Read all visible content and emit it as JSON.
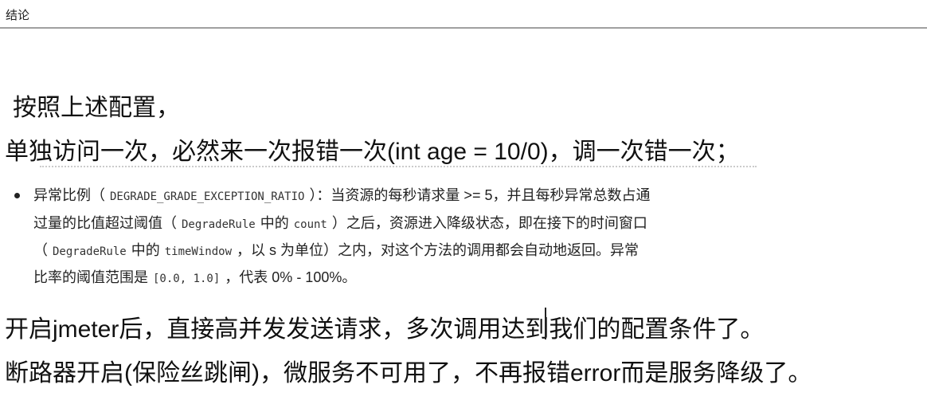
{
  "window": {
    "title": "结论"
  },
  "content": {
    "line1": "按照上述配置，",
    "line2": "单独访问一次，必然来一次报错一次(int age  = 10/0)，调一次错一次；",
    "bullet": {
      "label": "异常比例（",
      "code1": "DEGRADE_GRADE_EXCEPTION_RATIO",
      "text1": "）：当资源的每秒请求量 >= 5，并且每秒异常总数占通",
      "text2a": "过量的比值超过阈值（",
      "code2": "DegradeRule",
      "text2b": "中的",
      "code3": "count",
      "text2c": "）之后，资源进入降级状态，即在接下的时间窗口",
      "text3a": "（",
      "code4": "DegradeRule",
      "text3b": "中的",
      "code5": "timeWindow",
      "text3c": "，以 s 为单位）之内，对这个方法的调用都会自动地返回。异常",
      "text4a": "比率的阈值范围是",
      "code6": "[0.0, 1.0]",
      "text4b": "，代表 0% - 100%。"
    },
    "line3": "开启jmeter后，直接高并发发送请求，多次调用达到我们的配置条件了。",
    "line4": "断路器开启(保险丝跳闸)，微服务不可用了，不再报错error而是服务降级了。"
  }
}
